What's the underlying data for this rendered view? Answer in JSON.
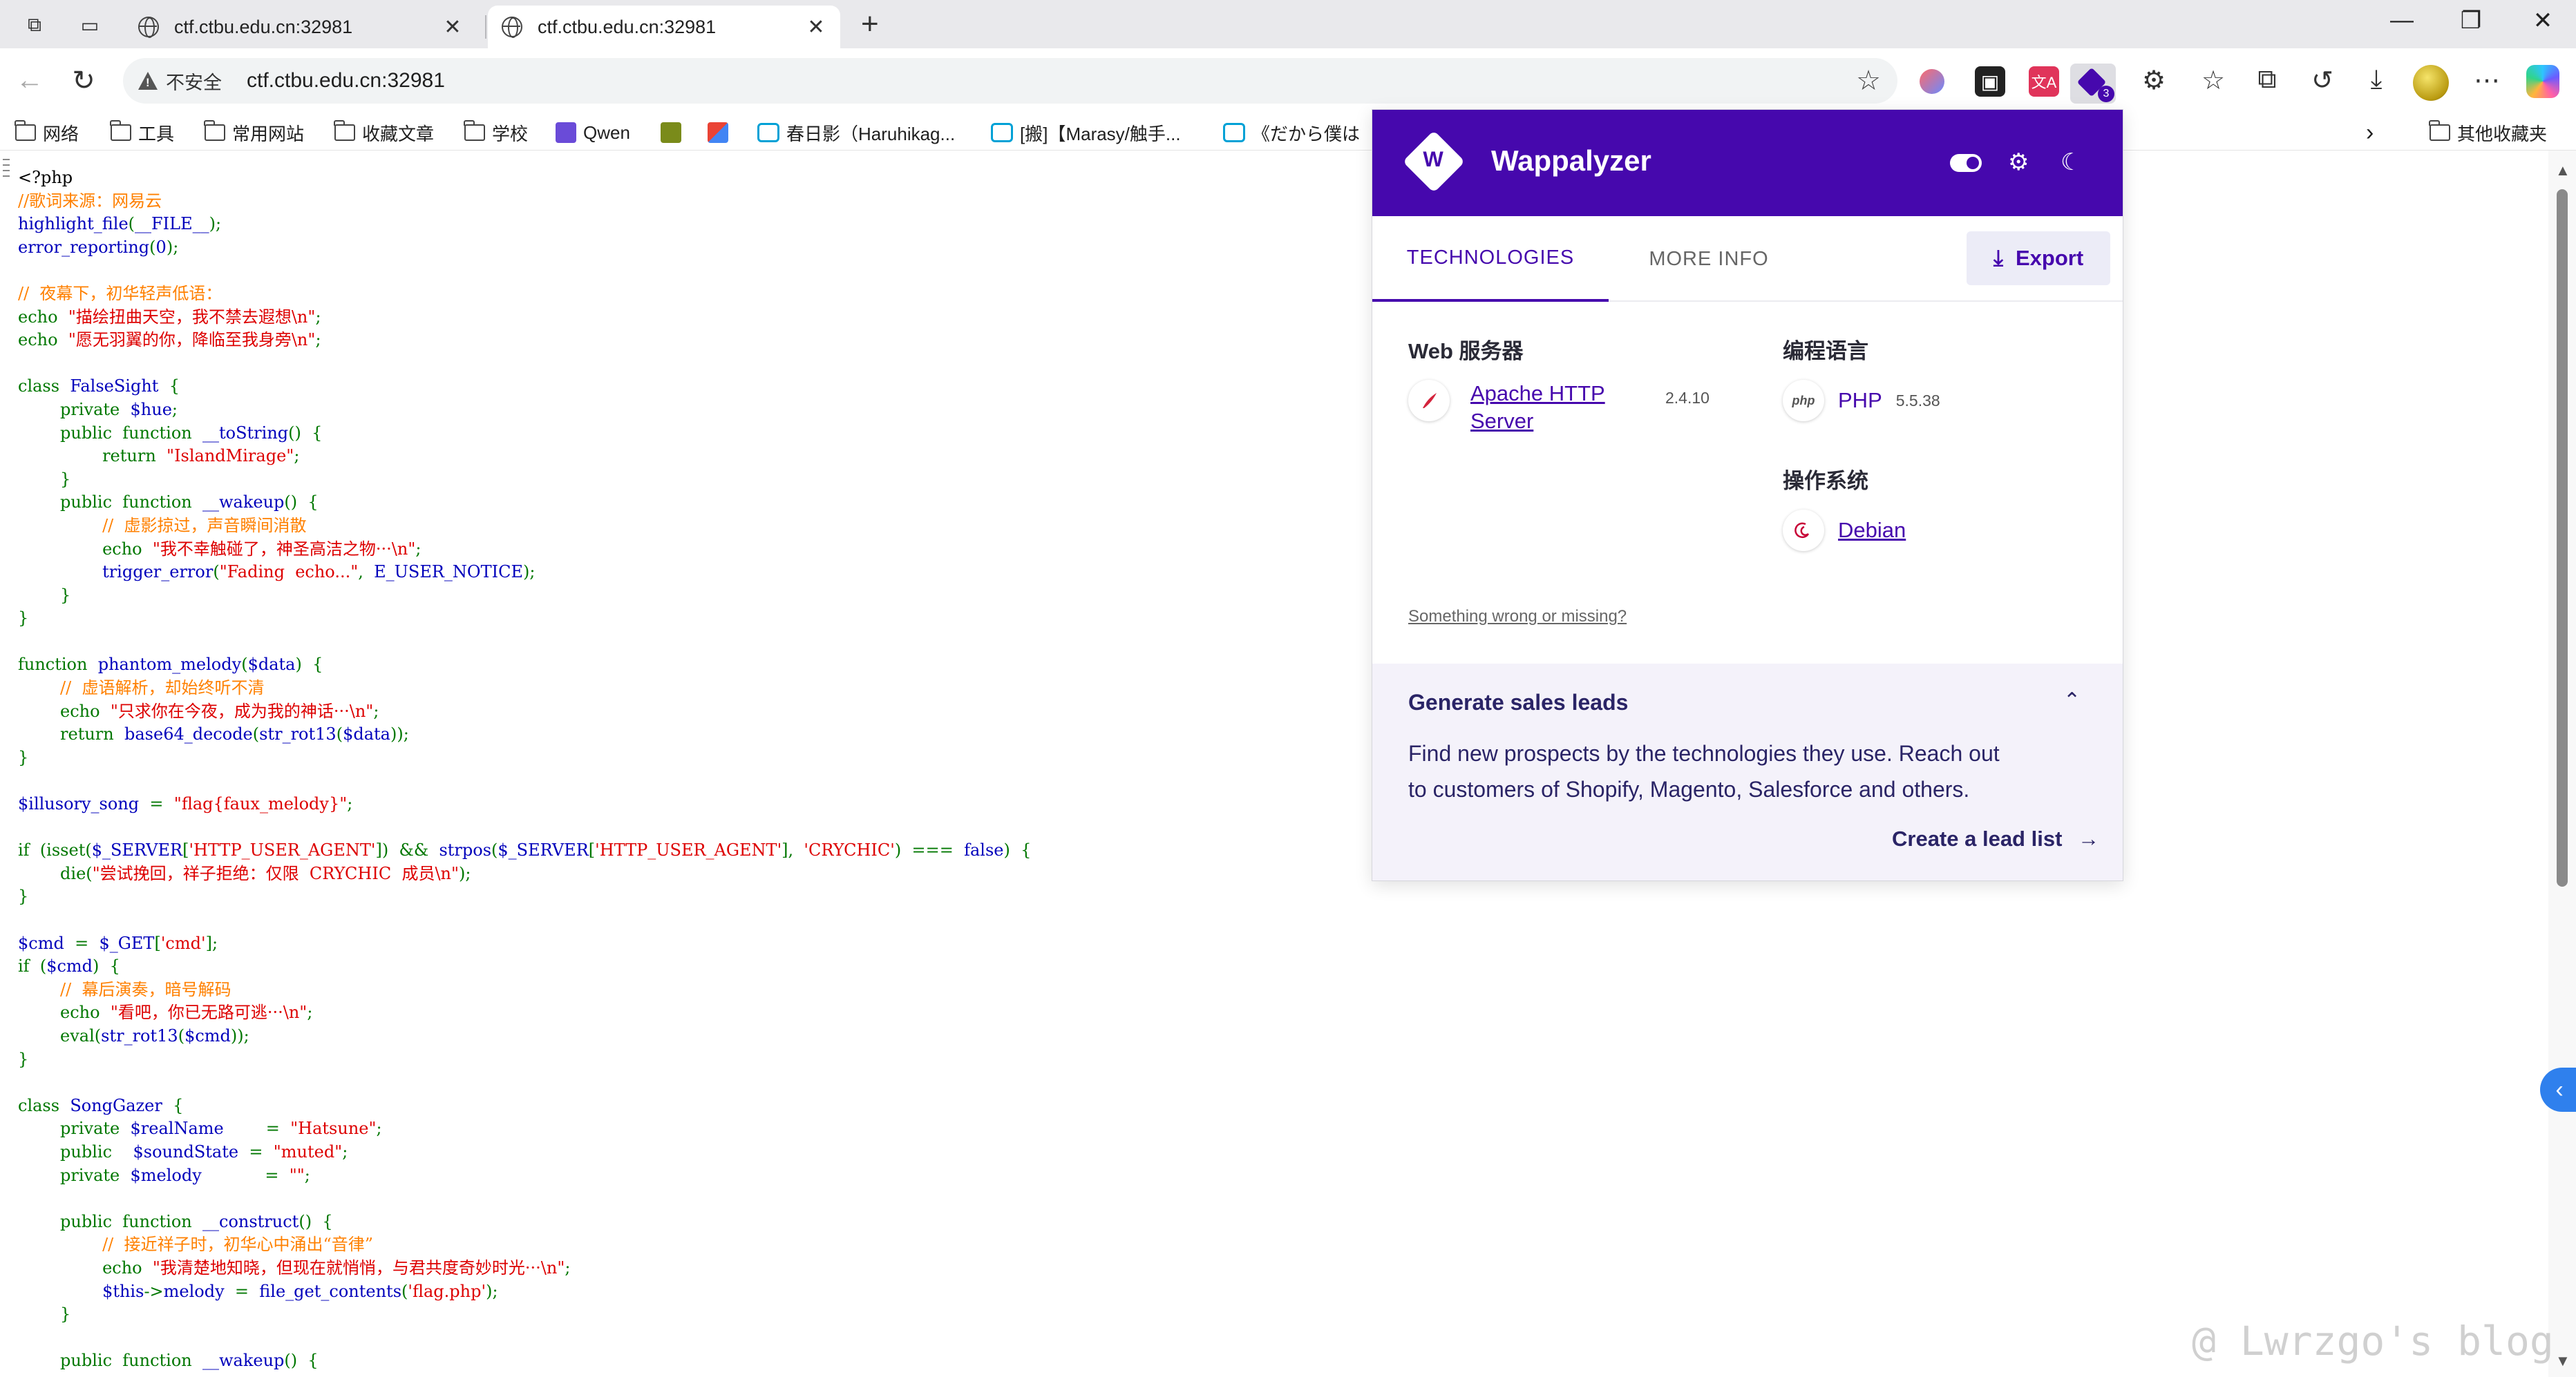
{
  "browser": {
    "tabs": [
      {
        "title": "ctf.ctbu.edu.cn:32981",
        "active": false
      },
      {
        "title": "ctf.ctbu.edu.cn:32981",
        "active": true
      }
    ],
    "insecure_label": "不安全",
    "url": "ctf.ctbu.edu.cn:32981",
    "wappalyzer_badge": "3",
    "icons": [
      "collections-icon",
      "tab-actions-icon",
      "back-icon",
      "reload-icon",
      "star-icon",
      "extensions-icon",
      "favorites-icon",
      "collections-icon",
      "history-icon",
      "download-icon",
      "more-icon",
      "minimize-icon",
      "maximize-icon",
      "close-icon"
    ]
  },
  "bookmarks": {
    "items": [
      "网络",
      "工具",
      "常用网站",
      "收藏文章",
      "学校",
      "Qwen",
      "",
      "",
      "春日影（Haruhikag...",
      "[搬]【Marasy/触手...",
      "《だから僕は"
    ],
    "other": "其他收藏夹"
  },
  "code": {
    "lines": [
      [
        [
          "html",
          "<?php"
        ]
      ],
      [
        [
          "comment",
          "//歌词来源：网易云"
        ]
      ],
      [
        [
          "default",
          "highlight_file"
        ],
        [
          "keyword",
          "("
        ],
        [
          "default",
          "__FILE__"
        ],
        [
          "keyword",
          ");"
        ]
      ],
      [
        [
          "default",
          "error_reporting"
        ],
        [
          "keyword",
          "("
        ],
        [
          "default",
          "0"
        ],
        [
          "keyword",
          ");"
        ]
      ],
      [],
      [
        [
          "comment",
          "//  夜幕下，初华轻声低语："
        ]
      ],
      [
        [
          "keyword",
          "echo  "
        ],
        [
          "string",
          "\"描绘扭曲天空，我不禁去遐想\\n\""
        ],
        [
          "keyword",
          ";"
        ]
      ],
      [
        [
          "keyword",
          "echo  "
        ],
        [
          "string",
          "\"愿无羽翼的你，降临至我身旁\\n\""
        ],
        [
          "keyword",
          ";"
        ]
      ],
      [],
      [
        [
          "keyword",
          "class  "
        ],
        [
          "default",
          "FalseSight  "
        ],
        [
          "keyword",
          "{"
        ]
      ],
      [
        [
          "keyword",
          "        private  "
        ],
        [
          "default",
          "$hue"
        ],
        [
          "keyword",
          ";"
        ]
      ],
      [
        [
          "keyword",
          "        public  function  "
        ],
        [
          "default",
          "__toString"
        ],
        [
          "keyword",
          "()  {"
        ]
      ],
      [
        [
          "keyword",
          "                return  "
        ],
        [
          "string",
          "\"IslandMirage\""
        ],
        [
          "keyword",
          ";"
        ]
      ],
      [
        [
          "keyword",
          "        }"
        ]
      ],
      [
        [
          "keyword",
          "        public  function  "
        ],
        [
          "default",
          "__wakeup"
        ],
        [
          "keyword",
          "()  {"
        ]
      ],
      [
        [
          "comment",
          "                //  虚影掠过，声音瞬间消散"
        ]
      ],
      [
        [
          "keyword",
          "                echo  "
        ],
        [
          "string",
          "\"我不幸触碰了，神圣高洁之物···\\n\""
        ],
        [
          "keyword",
          ";"
        ]
      ],
      [
        [
          "default",
          "                trigger_error"
        ],
        [
          "keyword",
          "("
        ],
        [
          "string",
          "\"Fading  echo...\""
        ],
        [
          "keyword",
          ",  "
        ],
        [
          "default",
          "E_USER_NOTICE"
        ],
        [
          "keyword",
          ");"
        ]
      ],
      [
        [
          "keyword",
          "        }"
        ]
      ],
      [
        [
          "keyword",
          "}"
        ]
      ],
      [],
      [
        [
          "keyword",
          "function  "
        ],
        [
          "default",
          "phantom_melody"
        ],
        [
          "keyword",
          "("
        ],
        [
          "default",
          "$data"
        ],
        [
          "keyword",
          ")  {"
        ]
      ],
      [
        [
          "comment",
          "        //  虚语解析，却始终听不清"
        ]
      ],
      [
        [
          "keyword",
          "        echo  "
        ],
        [
          "string",
          "\"只求你在今夜，成为我的神话···\\n\""
        ],
        [
          "keyword",
          ";"
        ]
      ],
      [
        [
          "keyword",
          "        return  "
        ],
        [
          "default",
          "base64_decode"
        ],
        [
          "keyword",
          "("
        ],
        [
          "default",
          "str_rot13"
        ],
        [
          "keyword",
          "("
        ],
        [
          "default",
          "$data"
        ],
        [
          "keyword",
          "));"
        ]
      ],
      [
        [
          "keyword",
          "}"
        ]
      ],
      [],
      [
        [
          "default",
          "$illusory_song  "
        ],
        [
          "keyword",
          "=  "
        ],
        [
          "string",
          "\"flag{faux_melody}\""
        ],
        [
          "keyword",
          ";"
        ]
      ],
      [],
      [
        [
          "keyword",
          "if  (isset("
        ],
        [
          "default",
          "$_SERVER"
        ],
        [
          "keyword",
          "["
        ],
        [
          "string",
          "'HTTP_USER_AGENT'"
        ],
        [
          "keyword",
          "])  &&  "
        ],
        [
          "default",
          "strpos"
        ],
        [
          "keyword",
          "("
        ],
        [
          "default",
          "$_SERVER"
        ],
        [
          "keyword",
          "["
        ],
        [
          "string",
          "'HTTP_USER_AGENT'"
        ],
        [
          "keyword",
          "],  "
        ],
        [
          "string",
          "'CRYCHIC'"
        ],
        [
          "keyword",
          ")  ===  "
        ],
        [
          "default",
          "false"
        ],
        [
          "keyword",
          ")  {"
        ]
      ],
      [
        [
          "keyword",
          "        die("
        ],
        [
          "string",
          "\"尝试挽回，祥子拒绝：仅限  CRYCHIC  成员\\n\""
        ],
        [
          "keyword",
          ");"
        ]
      ],
      [
        [
          "keyword",
          "}"
        ]
      ],
      [],
      [
        [
          "default",
          "$cmd  "
        ],
        [
          "keyword",
          "=  "
        ],
        [
          "default",
          "$_GET"
        ],
        [
          "keyword",
          "["
        ],
        [
          "string",
          "'cmd'"
        ],
        [
          "keyword",
          "];"
        ]
      ],
      [
        [
          "keyword",
          "if  ("
        ],
        [
          "default",
          "$cmd"
        ],
        [
          "keyword",
          ")  {"
        ]
      ],
      [
        [
          "comment",
          "        //  幕后演奏，暗号解码"
        ]
      ],
      [
        [
          "keyword",
          "        echo  "
        ],
        [
          "string",
          "\"看吧，你已无路可逃···\\n\""
        ],
        [
          "keyword",
          ";"
        ]
      ],
      [
        [
          "keyword",
          "        eval("
        ],
        [
          "default",
          "str_rot13"
        ],
        [
          "keyword",
          "("
        ],
        [
          "default",
          "$cmd"
        ],
        [
          "keyword",
          "));"
        ]
      ],
      [
        [
          "keyword",
          "}"
        ]
      ],
      [],
      [
        [
          "keyword",
          "class  "
        ],
        [
          "default",
          "SongGazer  "
        ],
        [
          "keyword",
          "{"
        ]
      ],
      [
        [
          "keyword",
          "        private  "
        ],
        [
          "default",
          "$realName        "
        ],
        [
          "keyword",
          "=  "
        ],
        [
          "string",
          "\"Hatsune\""
        ],
        [
          "keyword",
          ";"
        ]
      ],
      [
        [
          "keyword",
          "        public    "
        ],
        [
          "default",
          "$soundState  "
        ],
        [
          "keyword",
          "=  "
        ],
        [
          "string",
          "\"muted\""
        ],
        [
          "keyword",
          ";"
        ]
      ],
      [
        [
          "keyword",
          "        private  "
        ],
        [
          "default",
          "$melody            "
        ],
        [
          "keyword",
          "=  "
        ],
        [
          "string",
          "\"\""
        ],
        [
          "keyword",
          ";"
        ]
      ],
      [],
      [
        [
          "keyword",
          "        public  function  "
        ],
        [
          "default",
          "__construct"
        ],
        [
          "keyword",
          "()  {"
        ]
      ],
      [
        [
          "comment",
          "                //  接近祥子时，初华心中涌出“音律”"
        ]
      ],
      [
        [
          "keyword",
          "                echo  "
        ],
        [
          "string",
          "\"我清楚地知晓，但现在就悄悄，与君共度奇妙时光···\\n\""
        ],
        [
          "keyword",
          ";"
        ]
      ],
      [
        [
          "default",
          "                $this"
        ],
        [
          "keyword",
          "->"
        ],
        [
          "default",
          "melody  "
        ],
        [
          "keyword",
          "=  "
        ],
        [
          "default",
          "file_get_contents"
        ],
        [
          "keyword",
          "("
        ],
        [
          "string",
          "'flag.php'"
        ],
        [
          "keyword",
          ");"
        ]
      ],
      [
        [
          "keyword",
          "        }"
        ]
      ],
      [],
      [
        [
          "keyword",
          "        public  function  "
        ],
        [
          "default",
          "__wakeup"
        ],
        [
          "keyword",
          "()  {"
        ]
      ]
    ]
  },
  "watermark": "@ Lwrzgo's blog",
  "wappalyzer": {
    "title": "Wappalyzer",
    "tabs": {
      "technologies": "TECHNOLOGIES",
      "more_info": "MORE INFO"
    },
    "export": "Export",
    "categories": [
      {
        "name": "Web 服务器",
        "techs": [
          {
            "name": "Apache HTTP Server",
            "version": "2.4.10"
          }
        ]
      },
      {
        "name": "编程语言",
        "techs": [
          {
            "name": "PHP",
            "version": "5.5.38"
          }
        ]
      },
      {
        "name": "操作系统",
        "techs": [
          {
            "name": "Debian",
            "version": ""
          }
        ]
      }
    ],
    "feedback": "Something wrong or missing?",
    "leads": {
      "title": "Generate sales leads",
      "body": "Find new prospects by the technologies they use. Reach out to customers of Shopify, Magento, Salesforce and others.",
      "cta": "Create a lead list"
    },
    "brand_color": "#4608ad"
  }
}
